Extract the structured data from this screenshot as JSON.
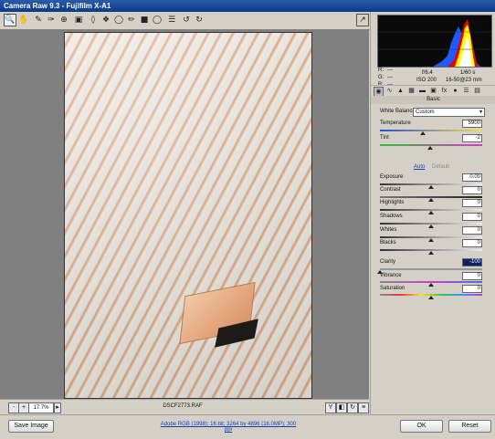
{
  "window": {
    "title": "Camera Raw 9.3  -  Fujifilm X-A1"
  },
  "toolbar": {
    "tools": [
      "zoom",
      "hand",
      "white-balance",
      "color-sampler",
      "targeted-adjustment",
      "crop",
      "straighten",
      "spot-removal",
      "red-eye",
      "adjustment-brush",
      "graduated-filter",
      "radial-filter",
      "preferences",
      "rotate-ccw",
      "rotate-cw"
    ],
    "fullscreen_icon": "fullscreen-icon"
  },
  "status": {
    "zoom": "17.7%",
    "filename": "DSCF2773.RAF"
  },
  "bottom": {
    "save_label": "Save Image",
    "workflow_link": "Adobe RGB (1998); 16 bit; 3264 by 4896 (16.0MP); 300 ppi",
    "ok_label": "OK",
    "reset_label": "Reset"
  },
  "info": {
    "r": "R:",
    "g": "G:",
    "b": "B:",
    "dash": "---",
    "aperture": "f/6.4",
    "shutter": "1/60 s",
    "iso": "ISO 200",
    "lens": "16-50@23 mm"
  },
  "panel": {
    "title": "Basic",
    "wb_label": "White Balance:",
    "wb_value": "Custom",
    "temp_label": "Temperature",
    "temp_value": "5900",
    "tint_label": "Tint",
    "tint_value": "-2",
    "auto": "Auto",
    "default": "Default",
    "exposure_label": "Exposure",
    "exposure_value": "0.00",
    "contrast_label": "Contrast",
    "contrast_value": "0",
    "highlights_label": "Highlights",
    "highlights_value": "0",
    "shadows_label": "Shadows",
    "shadows_value": "0",
    "whites_label": "Whites",
    "whites_value": "0",
    "blacks_label": "Blacks",
    "blacks_value": "0",
    "clarity_label": "Clarity",
    "clarity_value": "-100",
    "vibrance_label": "Vibrance",
    "vibrance_value": "0",
    "saturation_label": "Saturation",
    "saturation_value": "0"
  },
  "slider_levels": {
    "temperature": 0.42,
    "tint": 0.49,
    "exposure": 0.5,
    "contrast": 0.5,
    "highlights": 0.5,
    "shadows": 0.5,
    "whites": 0.5,
    "blacks": 0.5,
    "clarity": 0.0,
    "vibrance": 0.5,
    "saturation": 0.5
  },
  "colors": {
    "accent": "#0a246a",
    "link": "#1a3cb8"
  }
}
